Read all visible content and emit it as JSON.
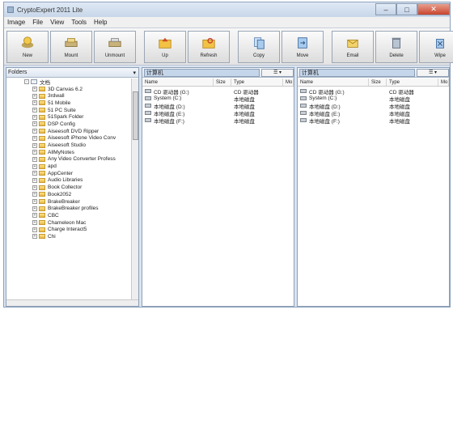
{
  "window": {
    "title": "CryptoExpert 2011 Lite",
    "controls": [
      "–",
      "□",
      "✕"
    ]
  },
  "menu": [
    "Image",
    "File",
    "View",
    "Tools",
    "Help"
  ],
  "toolbar": {
    "group1": [
      {
        "label": "New",
        "icon": "drive-new-icon"
      },
      {
        "label": "Mount",
        "icon": "drive-mount-icon"
      },
      {
        "label": "Unmount",
        "icon": "drive-unmount-icon"
      }
    ],
    "group2": [
      {
        "label": "Up",
        "icon": "folder-up-icon"
      },
      {
        "label": "Refresh",
        "icon": "folder-refresh-icon"
      }
    ],
    "group3": [
      {
        "label": "Copy",
        "icon": "copy-icon"
      },
      {
        "label": "Move",
        "icon": "move-icon"
      }
    ],
    "group4": [
      {
        "label": "Email",
        "icon": "email-icon"
      },
      {
        "label": "Delete",
        "icon": "delete-icon"
      },
      {
        "label": "Wipe",
        "icon": "wipe-icon"
      }
    ]
  },
  "tree": {
    "header": "Folders",
    "root": "文档",
    "items": [
      "3D Canvas 6.2",
      "3rdwall",
      "51 Mobile",
      "51 PC Suite",
      "51Spark Folder",
      "DSP Config",
      "Aiseesoft DVD Ripper",
      "Aiseesoft iPhone Video Conv",
      "Aiseesoft Studio",
      "AllMyNotes",
      "Any Video Converter Profess",
      "apd",
      "AppCenter",
      "Audio Libraries",
      "Book Collector",
      "Book2052",
      "BrakeBreaker",
      "BrakeBreaker profiles",
      "CBC",
      "Chameleon Mac",
      "Charge Interact5",
      "Chi"
    ]
  },
  "left_list": {
    "path": "计算机",
    "view": "☰ ▾",
    "columns": [
      "Name",
      "Size",
      "Type",
      "Mo"
    ],
    "rows": [
      {
        "name": "CD 驱动器 (G:)",
        "type": "CD 驱动器"
      },
      {
        "name": "System (C:)",
        "type": "本地磁盘"
      },
      {
        "name": "本地磁盘 (D:)",
        "type": "本地磁盘"
      },
      {
        "name": "本地磁盘 (E:)",
        "type": "本地磁盘"
      },
      {
        "name": "本地磁盘 (F:)",
        "type": "本地磁盘"
      }
    ]
  },
  "right_list": {
    "path": "计算机",
    "view": "☰ ▾",
    "columns": [
      "Name",
      "Size",
      "Type",
      "Mo"
    ],
    "rows": [
      {
        "name": "CD 驱动器 (G:)",
        "type": "CD 驱动器"
      },
      {
        "name": "System (C:)",
        "type": "本地磁盘"
      },
      {
        "name": "本地磁盘 (D:)",
        "type": "本地磁盘"
      },
      {
        "name": "本地磁盘 (E:)",
        "type": "本地磁盘"
      },
      {
        "name": "本地磁盘 (F:)",
        "type": "本地磁盘"
      }
    ]
  }
}
